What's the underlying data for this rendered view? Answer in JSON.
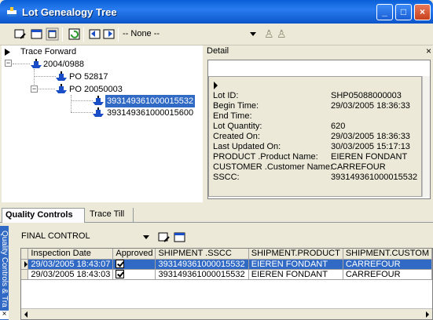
{
  "window": {
    "title": "Lot Genealogy Tree",
    "icon": "ship-icon",
    "controls": [
      "minimize-icon",
      "maximize-icon",
      "close-icon"
    ]
  },
  "toolbar": {
    "buttons": [
      "pencil-tool-icon",
      "window-icon",
      "list-window-icon",
      "refresh-icon",
      "back-icon",
      "forward-icon"
    ],
    "combo_value": "-- None --",
    "person_icons": [
      "person-icon",
      "person-icon"
    ]
  },
  "tree": {
    "root": "Trace Forward",
    "nodes": [
      {
        "label": "2004/0988"
      },
      {
        "label": "PO 52817"
      },
      {
        "label": "PO 20050003"
      },
      {
        "label": "393149361000015532",
        "selected": true
      },
      {
        "label": "393149361000015600"
      }
    ]
  },
  "detail": {
    "title": "Detail",
    "close": "×",
    "props": [
      {
        "label": "Lot ID:",
        "value": "SHP05088000003"
      },
      {
        "label": "Begin Time:",
        "value": "29/03/2005 18:36:33"
      },
      {
        "label": "End Time:",
        "value": ""
      },
      {
        "label": "Lot Quantity:",
        "value": "620"
      },
      {
        "label": "Created On:",
        "value": "29/03/2005 18:36:33"
      },
      {
        "label": "Last Updated On:",
        "value": "30/03/2005 15:17:13"
      },
      {
        "label": "PRODUCT .Product Name:",
        "value": "EIEREN FONDANT"
      },
      {
        "label": "CUSTOMER .Customer Name:",
        "value": "CARREFOUR"
      },
      {
        "label": "SSCC:",
        "value": "393149361000015532"
      }
    ]
  },
  "tabs": [
    {
      "label": "Quality Controls",
      "active": true
    },
    {
      "label": "Trace Till",
      "active": false
    }
  ],
  "side_panel": {
    "label": "Quality Controls & Tra"
  },
  "quality": {
    "combo_value": "FINAL CONTROL",
    "columns": [
      "Inspection Date",
      "Approved",
      "SHIPMENT .SSCC",
      "SHIPMENT.PRODUCT",
      "SHIPMENT.CUSTOM"
    ],
    "rows": [
      {
        "date": "29/03/2005 18:43:07",
        "approved": true,
        "sscc": "393149361000015532",
        "product": "EIEREN FONDANT",
        "customer": "CARREFOUR",
        "selected": true
      },
      {
        "date": "29/03/2005 18:43:03",
        "approved": true,
        "sscc": "393149361000015532",
        "product": "EIEREN FONDANT",
        "customer": "CARREFOUR",
        "selected": false
      }
    ]
  }
}
